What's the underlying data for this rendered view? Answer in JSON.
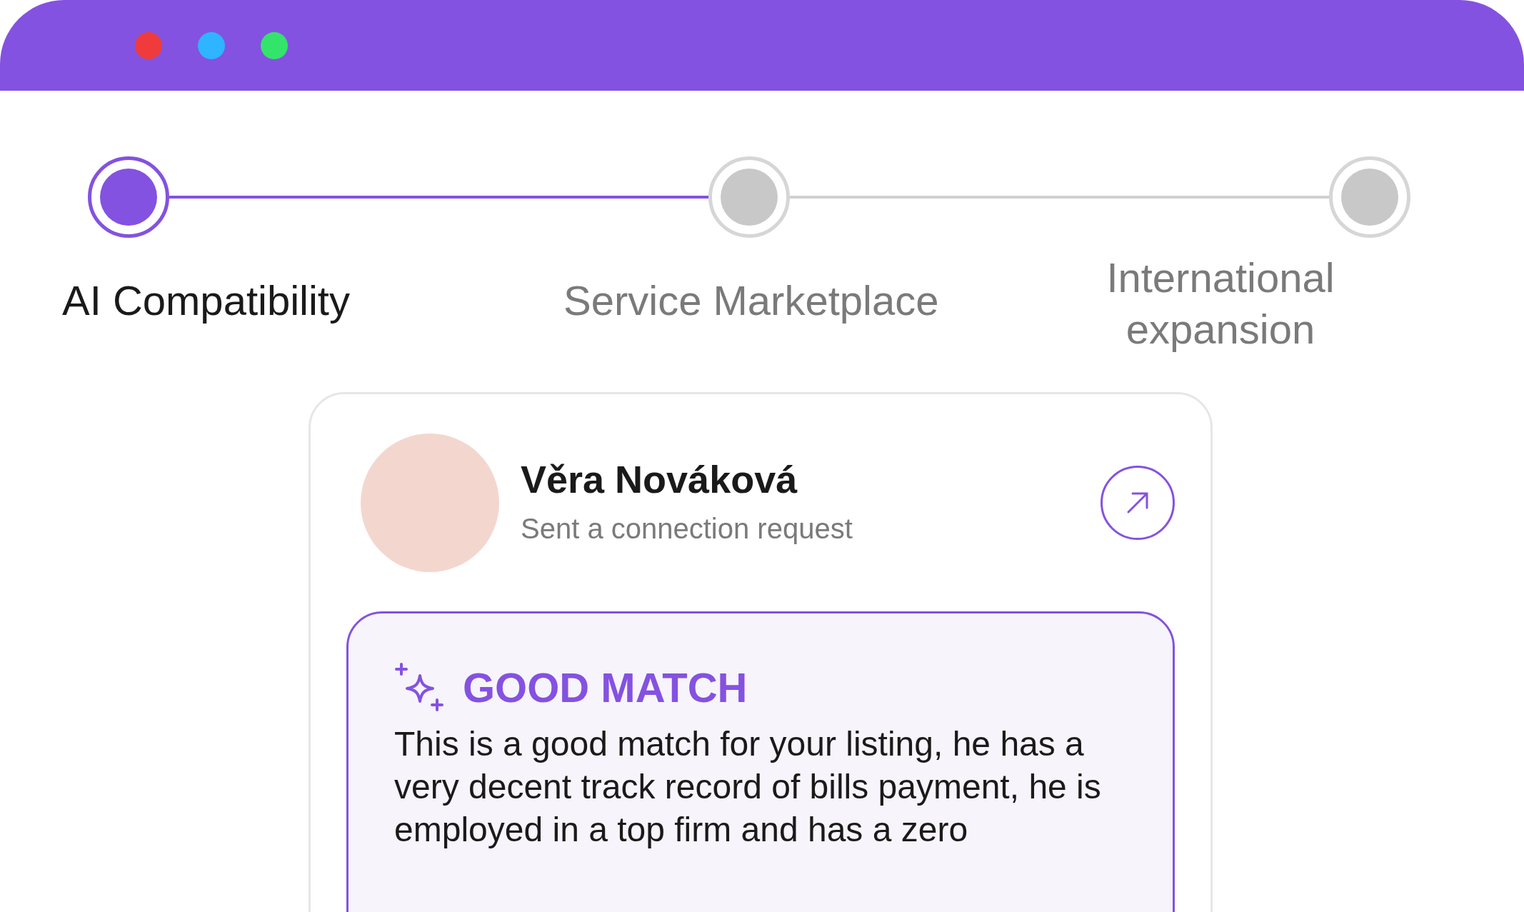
{
  "window": {
    "controls": [
      {
        "color": "#ef3b3b"
      },
      {
        "color": "#2fb4ff"
      },
      {
        "color": "#33e46b"
      }
    ]
  },
  "steps": [
    {
      "label": "AI Compatibility",
      "selected": true
    },
    {
      "label": "Service Marketplace",
      "selected": false
    },
    {
      "label": "International expansion",
      "selected": false
    }
  ],
  "card": {
    "name": "Věra Nováková",
    "subtitle": "Sent a connection request",
    "match": {
      "title": "GOOD MATCH",
      "text": "This is a good match for your listing, he has a very decent track record of bills payment, he is employed in a top firm and has a zero"
    }
  }
}
